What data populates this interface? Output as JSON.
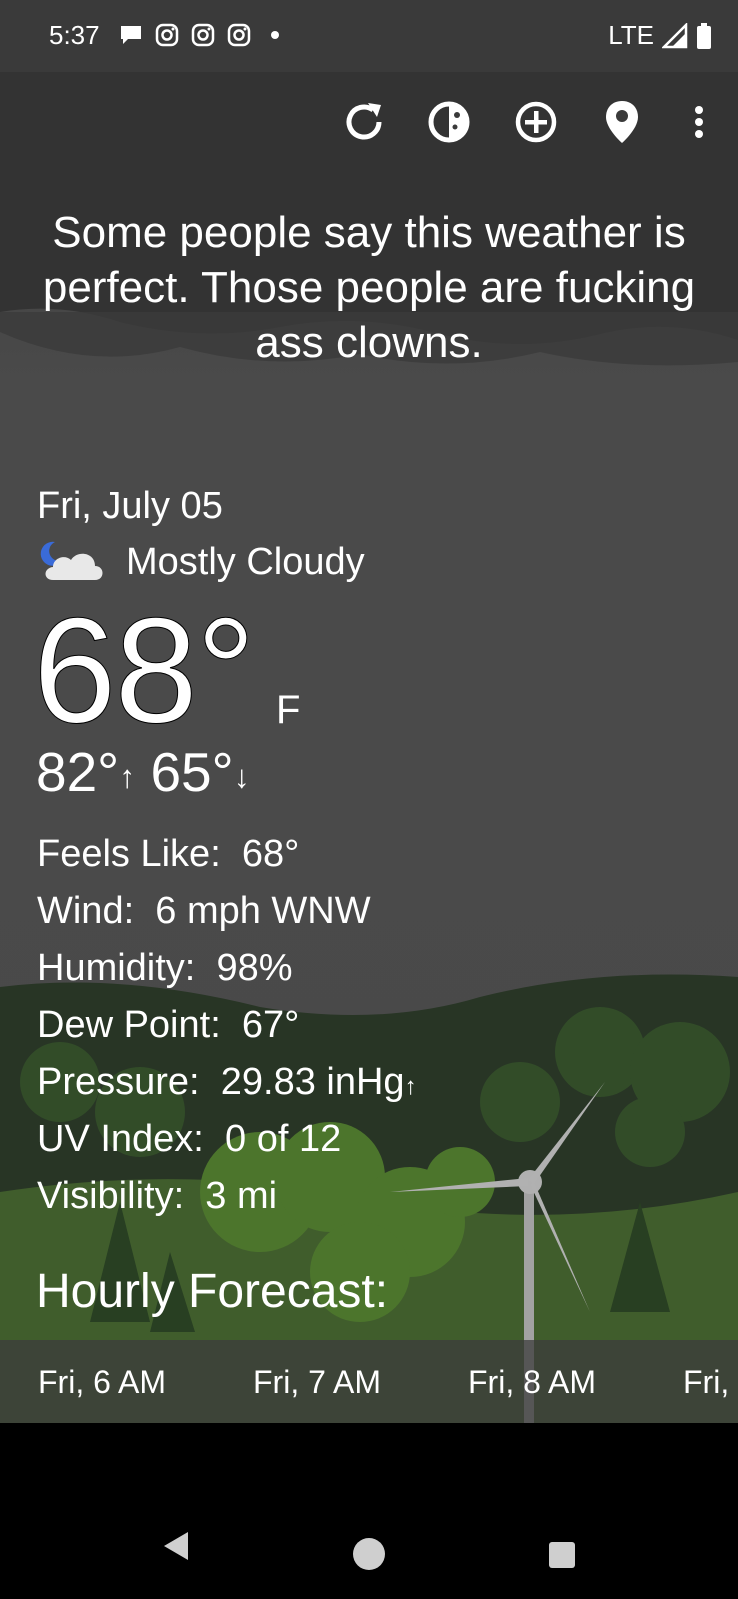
{
  "status_bar": {
    "time": "5:37",
    "network": "LTE",
    "notification_icons": [
      "chat-bubble-icon",
      "instagram-icon",
      "instagram-icon",
      "instagram-icon",
      "dot-icon"
    ]
  },
  "toolbar": {
    "icons": [
      "refresh-icon",
      "theme-icon",
      "add-location-icon",
      "location-pin-icon",
      "overflow-menu-icon"
    ]
  },
  "headline": "Some people say this weather is perfect. Those people are fucking ass clowns.",
  "current": {
    "date": "Fri, July 05",
    "condition": "Mostly Cloudy",
    "temperature": "68°",
    "unit": "F",
    "high": "82°",
    "low": "65°"
  },
  "details": [
    {
      "label": "Feels Like:",
      "value": "68°"
    },
    {
      "label": "Wind:",
      "value": "6 mph WNW"
    },
    {
      "label": "Humidity:",
      "value": "98%"
    },
    {
      "label": "Dew Point:",
      "value": "67°"
    },
    {
      "label": "Pressure:",
      "value": "29.83 inHg"
    },
    {
      "label": "UV Index:",
      "value": "0 of 12"
    },
    {
      "label": "Visibility:",
      "value": "3 mi"
    }
  ],
  "hourly": {
    "title": "Hourly Forecast:",
    "hours": [
      "Fri, 6 AM",
      "Fri, 7 AM",
      "Fri, 8 AM",
      "Fri,"
    ]
  },
  "colors": {
    "status_bar": "#3a3a3a",
    "sky": "#555555",
    "hills": "#2f4a2c",
    "grass": "#4c7a2e"
  }
}
